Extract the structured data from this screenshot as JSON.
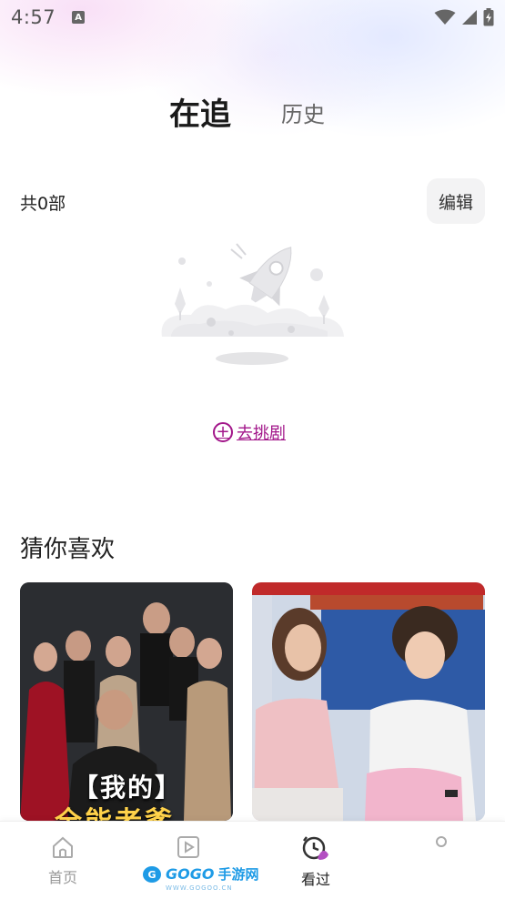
{
  "status_bar": {
    "time": "4:57",
    "notification_badge": "A"
  },
  "tabs": {
    "following": "在追",
    "history": "历史"
  },
  "list": {
    "count_label": "共0部",
    "edit_label": "编辑"
  },
  "empty_state": {
    "action_label": "去挑剧",
    "action_color": "#a2168a"
  },
  "recommend": {
    "title": "猜你喜欢",
    "cards": [
      {
        "overlay_text_line1": "【我的】",
        "overlay_text_line2": "全能老爹"
      },
      {
        "overlay_text": ""
      }
    ]
  },
  "bottom_nav": {
    "items": [
      {
        "label": "首页",
        "icon": "home-icon",
        "active": false
      },
      {
        "label": "",
        "icon": "play-icon",
        "active": false
      },
      {
        "label": "看过",
        "icon": "history-clock-icon",
        "active": true
      },
      {
        "label": "",
        "icon": "profile-icon",
        "active": false
      }
    ]
  },
  "watermark": {
    "logo": "GOGO",
    "name": "手游网",
    "url": "WWW.GOGOO.CN"
  }
}
